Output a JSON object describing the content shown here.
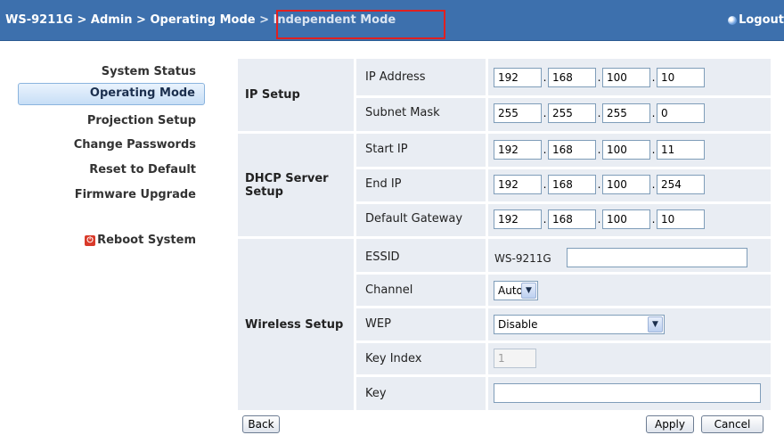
{
  "header": {
    "crumb_device": "WS-9211G",
    "crumb_sep1": " > ",
    "crumb_admin": "Admin",
    "crumb_sep2": " > ",
    "crumb_mode": "Operating Mode",
    "crumb_current": " > Independent Mode",
    "logout_label": "Logout"
  },
  "sidebar": {
    "items": [
      {
        "label": "System Status"
      },
      {
        "label": "Operating Mode"
      },
      {
        "label": "Projection Setup"
      },
      {
        "label": "Change Passwords"
      },
      {
        "label": "Reset to Default"
      },
      {
        "label": "Firmware Upgrade"
      }
    ],
    "reboot_label": "Reboot System"
  },
  "form": {
    "ip_setup": {
      "title": "IP Setup",
      "ip_address": {
        "label": "IP Address",
        "octets": [
          "192",
          "168",
          "100",
          "10"
        ]
      },
      "subnet_mask": {
        "label": "Subnet Mask",
        "octets": [
          "255",
          "255",
          "255",
          "0"
        ]
      }
    },
    "dhcp": {
      "title": "DHCP Server Setup",
      "start_ip": {
        "label": "Start IP",
        "octets": [
          "192",
          "168",
          "100",
          "11"
        ]
      },
      "end_ip": {
        "label": "End IP",
        "octets": [
          "192",
          "168",
          "100",
          "254"
        ]
      },
      "gateway": {
        "label": "Default Gateway",
        "octets": [
          "192",
          "168",
          "100",
          "10"
        ]
      }
    },
    "wireless": {
      "title": "Wireless Setup",
      "essid": {
        "label": "ESSID",
        "prefix": "WS-9211G",
        "value": ""
      },
      "channel": {
        "label": "Channel",
        "value": "Auto"
      },
      "wep": {
        "label": "WEP",
        "value": "Disable"
      },
      "key_index": {
        "label": "Key Index",
        "value": "1"
      },
      "key": {
        "label": "Key",
        "value": ""
      }
    }
  },
  "buttons": {
    "back": "Back",
    "apply": "Apply",
    "cancel": "Cancel"
  },
  "colors": {
    "header_bg": "#3d70ad",
    "panel_bg": "#e9edf3",
    "highlight": "#e02020"
  }
}
